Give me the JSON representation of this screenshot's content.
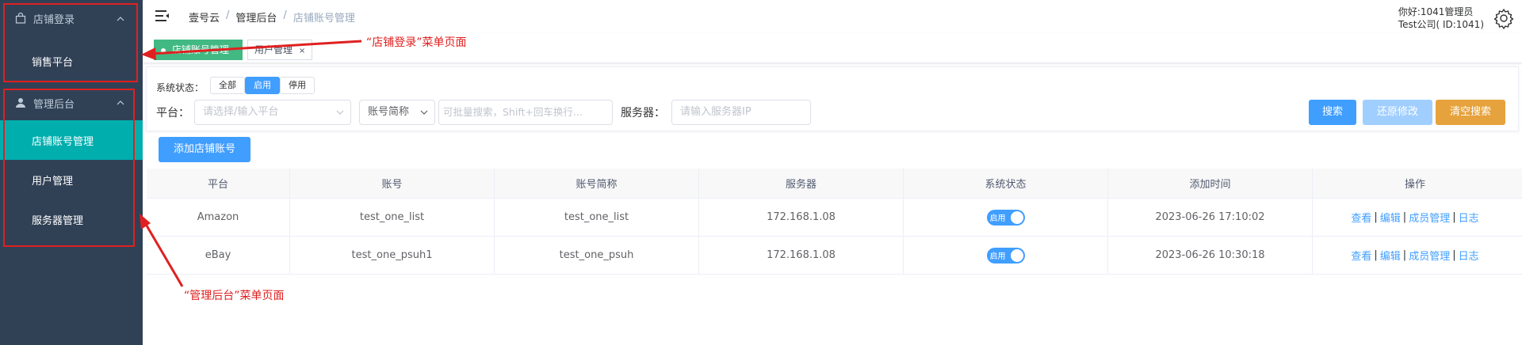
{
  "sidebar": {
    "group1": {
      "label": "店铺登录",
      "items": [
        {
          "label": "销售平台"
        }
      ]
    },
    "group2": {
      "label": "管理后台",
      "items": [
        {
          "label": "店铺账号管理",
          "active": true
        },
        {
          "label": "用户管理"
        },
        {
          "label": "服务器管理"
        }
      ]
    },
    "bg_color": "#304156",
    "active_color": "#00aeae"
  },
  "header": {
    "breadcrumb": [
      "壹号云",
      "管理后台",
      "店铺账号管理"
    ],
    "user_greeting": "你好:1041管理员",
    "company": "Test公司( ID:1041)"
  },
  "tags": [
    {
      "label": "店铺账号管理",
      "active": true
    },
    {
      "label": "用户管理",
      "close": "×"
    }
  ],
  "filter": {
    "status_label": "系统状态：",
    "status_buttons": [
      "全部",
      "启用",
      "停用"
    ],
    "platform_label": "平台：",
    "platform_placeholder": "请选择/输入平台",
    "account_type_value": "账号简称",
    "search_placeholder": "可批量搜索，Shift+回车换行...",
    "server_label": "服务器：",
    "server_placeholder": "请输入服务器IP",
    "search_btn": "搜索",
    "restore_btn": "还原修改",
    "clear_btn": "清空搜索"
  },
  "add_button": "添加店铺账号",
  "table": {
    "headers": [
      "平台",
      "账号",
      "账号简称",
      "服务器",
      "系统状态",
      "添加时间",
      "操作"
    ],
    "rows": [
      {
        "platform": "Amazon",
        "account": "test_one_list",
        "short": "test_one_list",
        "server": "172.168.1.08",
        "status": "启用",
        "time": "2023-06-26 17:10:02"
      },
      {
        "platform": "eBay",
        "account": "test_one_psuh1",
        "short": "test_one_psuh",
        "server": "172.168.1.08",
        "status": "启用",
        "time": "2023-06-26 10:30:18"
      }
    ],
    "ops": [
      "查看",
      "编辑",
      "成员管理",
      "日志"
    ]
  },
  "annotations": {
    "top": "“店铺登录”菜单页面",
    "bottom": "“管理后台”菜单页面",
    "color": "#e02020"
  }
}
